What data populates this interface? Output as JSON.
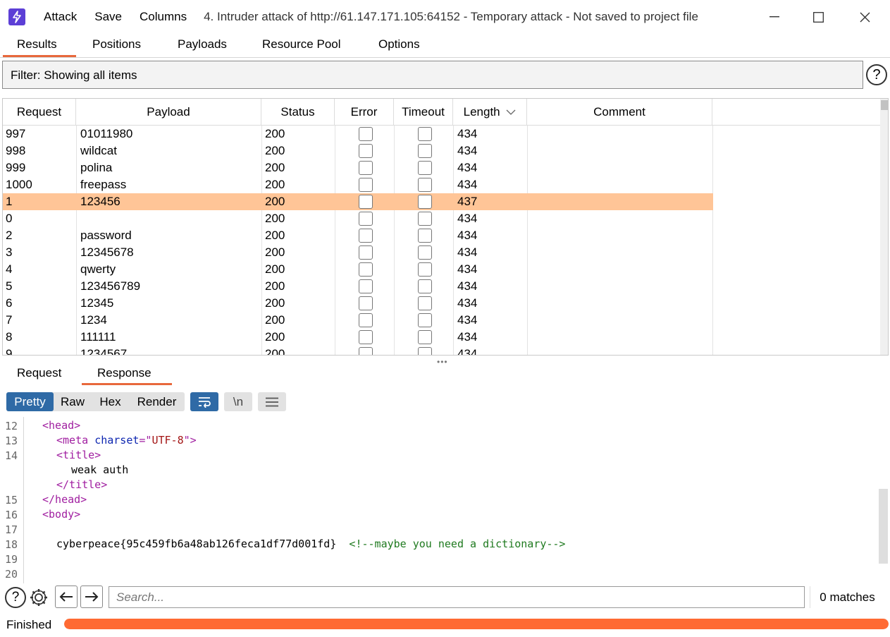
{
  "window": {
    "title": "4. Intruder attack of http://61.147.171.105:64152 - Temporary attack - Not saved to project file",
    "menu": [
      "Attack",
      "Save",
      "Columns"
    ]
  },
  "tabs": [
    "Results",
    "Positions",
    "Payloads",
    "Resource Pool",
    "Options"
  ],
  "filter": {
    "text": "Filter: Showing all items"
  },
  "table": {
    "headers": [
      "Request",
      "Payload",
      "Status",
      "Error",
      "Timeout",
      "Length",
      "Comment"
    ],
    "sort_column": "Length",
    "rows": [
      {
        "request": "997",
        "payload": "01011980",
        "status": "200",
        "length": "434"
      },
      {
        "request": "998",
        "payload": "wildcat",
        "status": "200",
        "length": "434"
      },
      {
        "request": "999",
        "payload": "polina",
        "status": "200",
        "length": "434"
      },
      {
        "request": "1000",
        "payload": "freepass",
        "status": "200",
        "length": "434"
      },
      {
        "request": "1",
        "payload": "123456",
        "status": "200",
        "length": "437"
      },
      {
        "request": "0",
        "payload": "",
        "status": "200",
        "length": "434"
      },
      {
        "request": "2",
        "payload": "password",
        "status": "200",
        "length": "434"
      },
      {
        "request": "3",
        "payload": "12345678",
        "status": "200",
        "length": "434"
      },
      {
        "request": "4",
        "payload": "qwerty",
        "status": "200",
        "length": "434"
      },
      {
        "request": "5",
        "payload": "123456789",
        "status": "200",
        "length": "434"
      },
      {
        "request": "6",
        "payload": "12345",
        "status": "200",
        "length": "434"
      },
      {
        "request": "7",
        "payload": "1234",
        "status": "200",
        "length": "434"
      },
      {
        "request": "8",
        "payload": "111111",
        "status": "200",
        "length": "434"
      },
      {
        "request": "9",
        "payload": "1234567",
        "status": "200",
        "length": "434"
      }
    ],
    "selected_row": "1"
  },
  "detail_tabs": [
    "Request",
    "Response"
  ],
  "view_modes": [
    "Pretty",
    "Raw",
    "Hex",
    "Render"
  ],
  "newline_button": "\\n",
  "code": {
    "line_numbers": [
      "12",
      "13",
      "14",
      "",
      "",
      "15",
      "16",
      "17",
      "18",
      "19",
      "20"
    ],
    "lines": [
      {
        "parts": [
          [
            "tag",
            "<head>"
          ]
        ]
      },
      {
        "parts": [
          [
            "tag",
            "<meta "
          ],
          [
            "attr",
            "charset"
          ],
          [
            "tag",
            "=\""
          ],
          [
            "str",
            "UTF-8"
          ],
          [
            "tag",
            "\">"
          ]
        ]
      },
      {
        "parts": [
          [
            "tag",
            "<title>"
          ]
        ]
      },
      {
        "parts": [
          [
            "plain",
            "weak auth"
          ]
        ]
      },
      {
        "parts": [
          [
            "tag",
            "</title>"
          ]
        ]
      },
      {
        "parts": [
          [
            "tag",
            "</head>"
          ]
        ]
      },
      {
        "parts": [
          [
            "tag",
            "<body>"
          ]
        ]
      },
      {
        "parts": []
      },
      {
        "parts": [
          [
            "plain",
            "cyberpeace{95c459fb6a48ab126feca1df77d001fd}  "
          ],
          [
            "cmt",
            "<!--maybe you need a dictionary-->"
          ]
        ]
      },
      {
        "parts": []
      },
      {
        "parts": []
      }
    ]
  },
  "search": {
    "placeholder": "Search...",
    "matches": "0 matches"
  },
  "status": {
    "text": "Finished",
    "progress": 1.0
  }
}
